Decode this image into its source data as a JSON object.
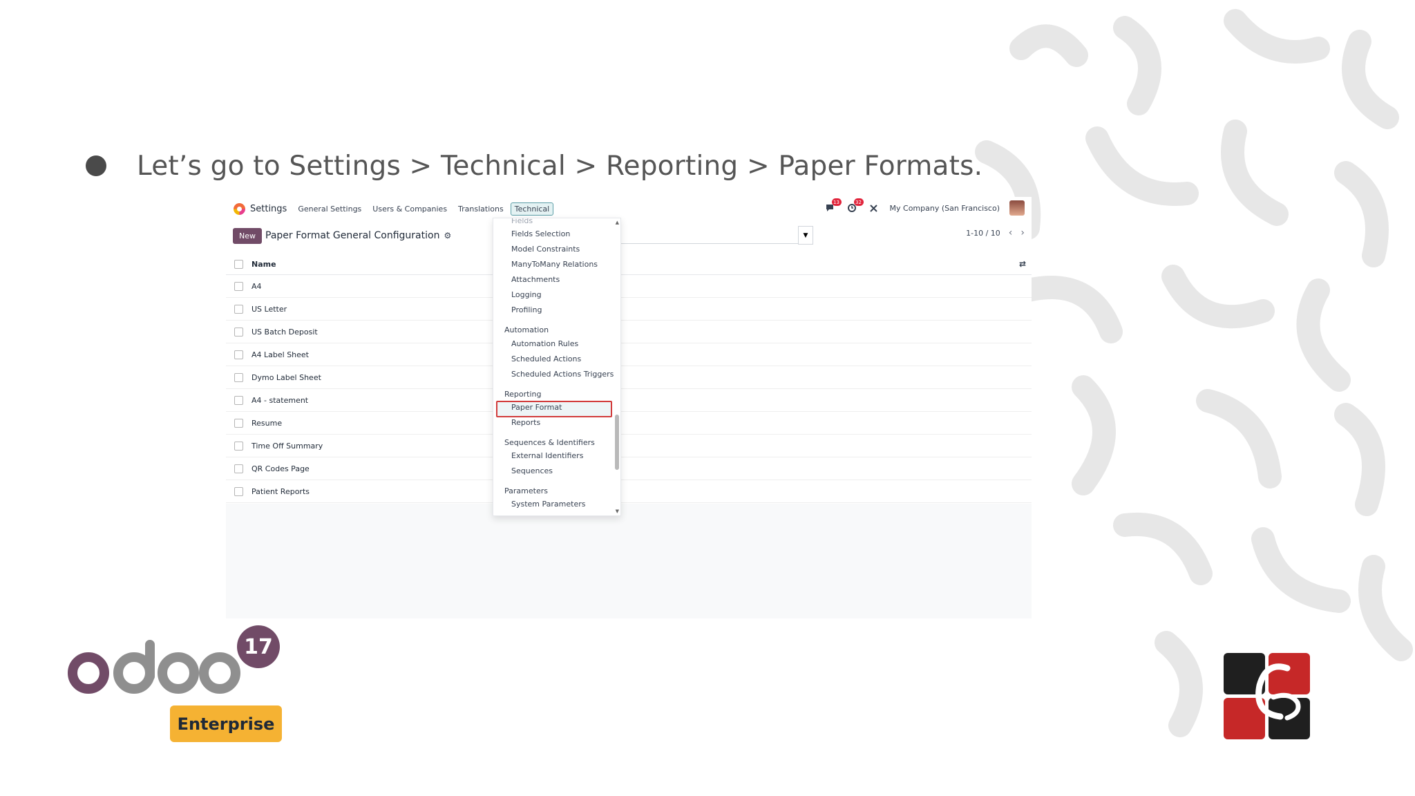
{
  "slide": {
    "heading": "Let’s go to Settings > Technical > Reporting > Paper Formats."
  },
  "odoo": {
    "app_name": "Settings",
    "menu": [
      "General Settings",
      "Users & Companies",
      "Translations",
      "Technical"
    ],
    "active_menu": "Technical",
    "topbar": {
      "messages_badge": "13",
      "activities_badge": "32",
      "company": "My Company (San Francisco)"
    },
    "control": {
      "new_label": "New",
      "title": "Paper Format General Configuration",
      "pager": "1-10 / 10"
    },
    "list": {
      "column_name": "Name",
      "rows": [
        "A4",
        "US Letter",
        "US Batch Deposit",
        "A4 Label Sheet",
        "Dymo Label Sheet",
        "A4 - statement",
        "Resume",
        "Time Off Summary",
        "QR Codes Page",
        "Patient Reports"
      ]
    },
    "dropdown": {
      "cut_top": "Fields",
      "items": {
        "fields_selection": "Fields Selection",
        "model_constraints": "Model Constraints",
        "m2m_relations": "ManyToMany Relations",
        "attachments": "Attachments",
        "logging": "Logging",
        "profiling": "Profiling",
        "automation": "Automation",
        "automation_rules": "Automation Rules",
        "scheduled_actions": "Scheduled Actions",
        "scheduled_triggers": "Scheduled Actions Triggers",
        "reporting": "Reporting",
        "paper_format": "Paper Format",
        "reports": "Reports",
        "sequences_identifiers": "Sequences & Identifiers",
        "external_identifiers": "External Identifiers",
        "sequences": "Sequences",
        "parameters": "Parameters",
        "system_parameters": "System Parameters"
      }
    }
  },
  "branding": {
    "version": "17",
    "edition": "Enterprise"
  },
  "colors": {
    "odoo_purple": "#714b67",
    "enterprise_orange": "#f5b233",
    "highlight_red": "#d23b3b"
  }
}
